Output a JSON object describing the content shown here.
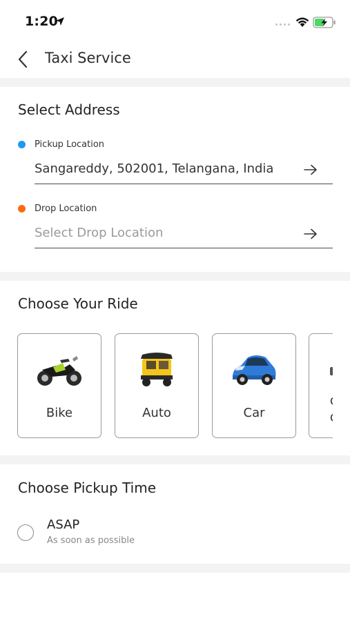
{
  "status_bar": {
    "time": "1:20",
    "location_icon": "location-arrow-icon",
    "wifi_icon": "wifi-icon",
    "battery_icon": "battery-charging-icon",
    "battery_color": "#4cd964"
  },
  "nav": {
    "back_icon": "chevron-left-icon",
    "title": "Taxi Service"
  },
  "address": {
    "title": "Select Address",
    "pickup": {
      "label": "Pickup Location",
      "value": "Sangareddy, 502001, Telangana, India",
      "dot_color": "#1e9bf0"
    },
    "drop": {
      "label": "Drop Location",
      "placeholder": "Select Drop Location",
      "dot_color": "#ff6a13"
    }
  },
  "ride": {
    "title": "Choose Your Ride",
    "options": [
      {
        "label": "Bike",
        "icon": "motorbike-icon"
      },
      {
        "label": "Auto",
        "icon": "auto-rickshaw-icon"
      },
      {
        "label": "Car",
        "icon": "car-icon"
      },
      {
        "label": "",
        "icon": "vehicle-icon",
        "peek_lines": [
          "C",
          "C"
        ]
      }
    ]
  },
  "pickup_time": {
    "title": "Choose Pickup Time",
    "options": [
      {
        "label": "ASAP",
        "sublabel": "As soon as possible",
        "selected": false
      }
    ]
  },
  "colors": {
    "separator": "#f3f3f3",
    "border": "#9a9a9a",
    "text": "#222222"
  }
}
